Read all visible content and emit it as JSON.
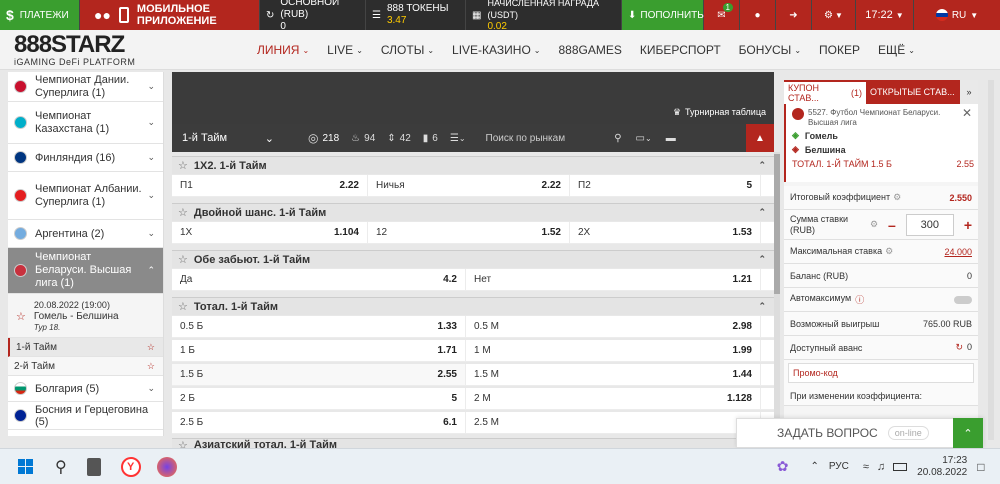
{
  "topbar": {
    "payments": "ПЛАТЕЖИ",
    "mobile": "МОБИЛЬНОЕ ПРИЛОЖЕНИЕ",
    "main_label": "ОСНОВНОЙ (RUB)",
    "main_value": "0",
    "tokens_label": "888 ТОКЕНЫ",
    "tokens_value": "3.47",
    "reward_label": "НАЧИСЛЕННАЯ НАГРАДА (USDT)",
    "reward_value": "0.02",
    "deposit": "ПОПОЛНИТЬ",
    "mail_count": "1",
    "time": "17:22",
    "lang": "RU"
  },
  "logo": {
    "brand": "888STARZ",
    "tagline": "iGAMING DeFi PLATFORM"
  },
  "nav": [
    "ЛИНИЯ",
    "LIVE",
    "СЛОТЫ",
    "LIVE-КАЗИНО",
    "888GAMES",
    "КИБЕРСПОРТ",
    "БОНУСЫ",
    "ПОКЕР",
    "ЕЩЁ"
  ],
  "sidebar": {
    "items": [
      {
        "label": "Чемпионат Дании. Суперлига (1)",
        "color": "#c8102e"
      },
      {
        "label": "Чемпионат Казахстана (1)",
        "color": "#00afca"
      },
      {
        "label": "Финляндия (16)",
        "color": "#003580"
      },
      {
        "label": "Чемпионат Албании. Суперлига (1)",
        "color": "#e41e20"
      },
      {
        "label": "Аргентина (2)",
        "color": "#74acdf"
      },
      {
        "label": "Чемпионат Беларуси. Высшая лига (1)",
        "color": "#c8313e"
      }
    ],
    "match_date": "20.08.2022 (19:00)",
    "match_name": "Гомель - Белшина",
    "match_round": "Тур 18.",
    "half1": "1-й Тайм",
    "half2": "2-й Тайм",
    "items2": [
      {
        "label": "Болгария (5)",
        "color": "#00966e"
      },
      {
        "label": "Босния и Герцеговина (5)",
        "color": "#002395"
      }
    ]
  },
  "hero": {
    "standings": "Турнирная таблица"
  },
  "filter": {
    "period": "1-й Тайм",
    "c1": "218",
    "c2": "94",
    "c3": "42",
    "c4": "6",
    "search_placeholder": "Поиск по рынкам"
  },
  "markets": [
    {
      "title": "1Х2. 1-й Тайм",
      "rows": [
        [
          [
            "П1",
            "2.22"
          ],
          [
            "Ничья",
            "2.22"
          ],
          [
            "П2",
            "5"
          ]
        ]
      ]
    },
    {
      "title": "Двойной шанс. 1-й Тайм",
      "rows": [
        [
          [
            "1Х",
            "1.104"
          ],
          [
            "12",
            "1.52"
          ],
          [
            "2Х",
            "1.53"
          ]
        ]
      ]
    },
    {
      "title": "Обе забьют. 1-й Тайм",
      "rows": [
        [
          [
            "Да",
            "4.2"
          ],
          [
            "Нет",
            "1.21"
          ]
        ]
      ]
    },
    {
      "title": "Тотал. 1-й Тайм",
      "rows": [
        [
          [
            "0.5 Б",
            "1.33"
          ],
          [
            "0.5 М",
            "2.98"
          ]
        ],
        [
          [
            "1 Б",
            "1.71"
          ],
          [
            "1 М",
            "1.99"
          ]
        ],
        [
          [
            "1.5 Б",
            "2.55"
          ],
          [
            "1.5 М",
            "1.44"
          ]
        ],
        [
          [
            "2 Б",
            "5"
          ],
          [
            "2 М",
            "1.128"
          ]
        ],
        [
          [
            "2.5 Б",
            "6.1"
          ],
          [
            "2.5 М",
            ""
          ]
        ]
      ]
    },
    {
      "title": "Азиатский тотал. 1-й Тайм",
      "rows": []
    }
  ],
  "coupon": {
    "tab1": "КУПОН СТАВ...",
    "tab1_count": "(1)",
    "tab2": "ОТКРЫТЫЕ СТАВ...",
    "event": "5527. Футбол Чемпионат Беларуси. Высшая лига",
    "team1": "Гомель",
    "team2": "Белшина",
    "bet": "ТОТАЛ. 1-Й ТАЙМ 1.5 Б",
    "bet_odds": "2.55",
    "total_label": "Итоговый коэффициент",
    "total_value": "2.550",
    "stake_label": "Сумма ставки (RUB)",
    "stake_value": "300",
    "max_label": "Максимальная ставка",
    "max_value": "24.000",
    "balance_label": "Баланс (RUB)",
    "balance_value": "0",
    "automax_label": "Автомаксимум",
    "win_label": "Возможный выигрыш",
    "win_value": "765.00 RUB",
    "advance_label": "Доступный аванс",
    "advance_value": "0",
    "promo_placeholder": "Промо-код",
    "change_label": "При изменении коэффициента:"
  },
  "ask": {
    "label": "ЗАДАТЬ ВОПРОС",
    "status": "on-line"
  },
  "taskbar": {
    "lang": "РУС",
    "time": "17:23",
    "date": "20.08.2022"
  }
}
